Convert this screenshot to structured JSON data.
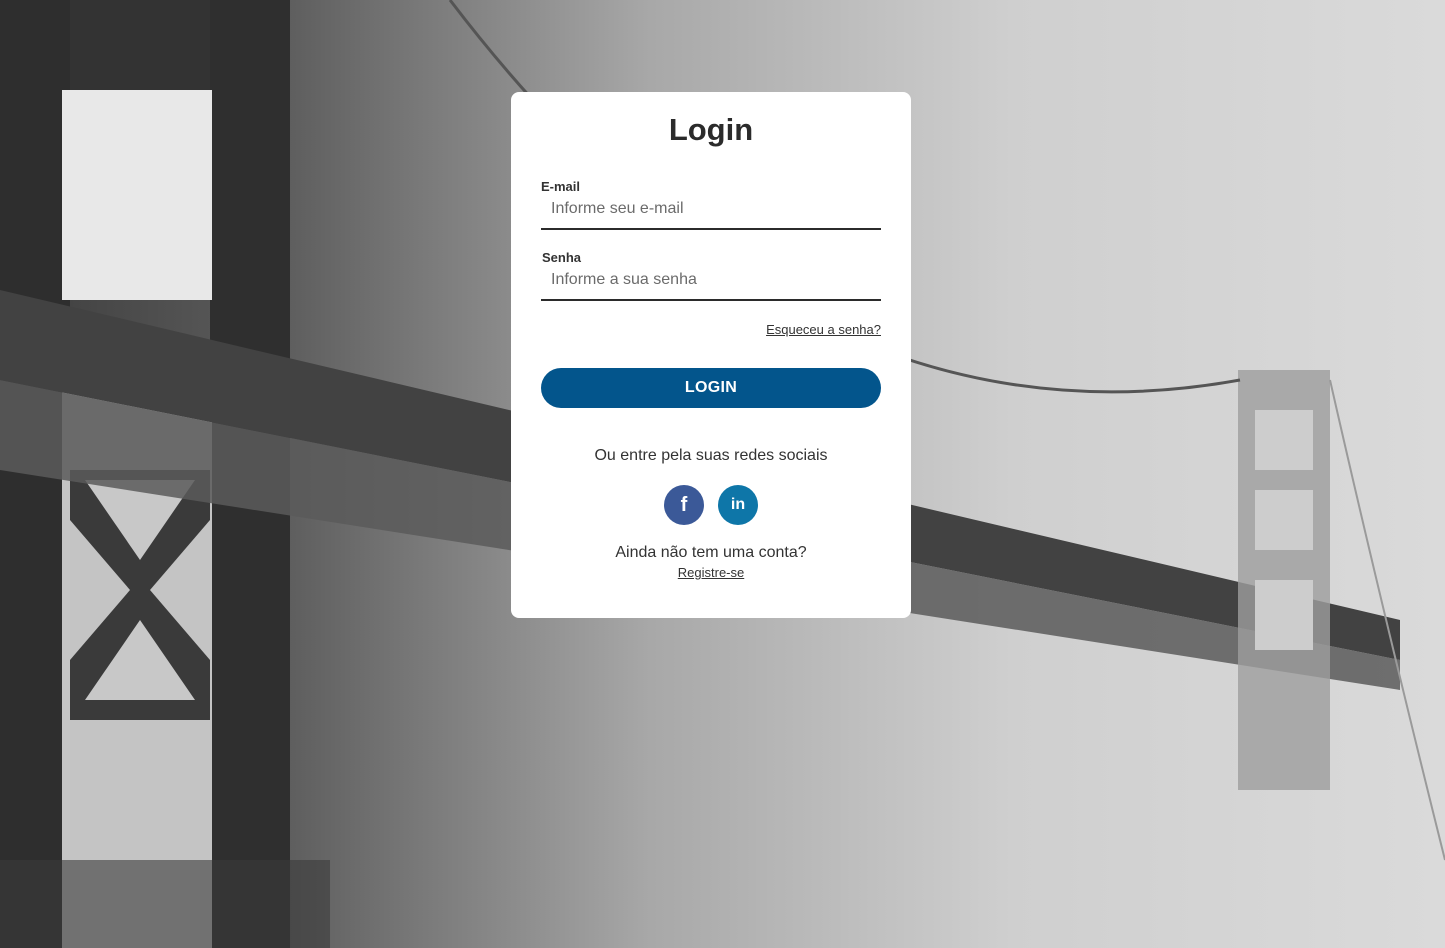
{
  "login": {
    "title": "Login",
    "email": {
      "label": "E-mail",
      "placeholder": "Informe seu e-mail",
      "value": ""
    },
    "password": {
      "label": "Senha",
      "placeholder": "Informe a sua senha",
      "value": ""
    },
    "forgot_password": "Esqueceu a senha?",
    "submit_label": "LOGIN",
    "social_prompt": "Ou entre pela suas redes sociais",
    "social": [
      {
        "icon": "facebook-icon",
        "glyph": "f",
        "color": "#3b5998"
      },
      {
        "icon": "linkedin-icon",
        "glyph": "in",
        "color": "#0e76a8"
      }
    ],
    "no_account": "Ainda não tem uma conta?",
    "register": "Registre-se"
  },
  "colors": {
    "button": "#03558c",
    "card": "#ffffff"
  }
}
